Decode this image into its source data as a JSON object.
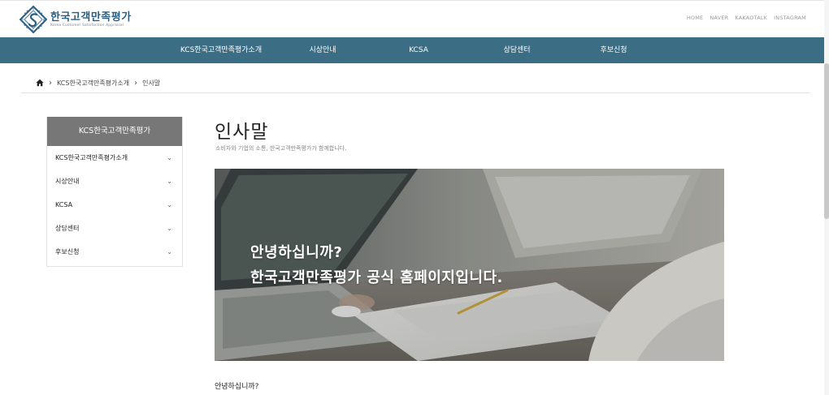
{
  "header": {
    "logo_title": "한국고객만족평가",
    "logo_subtitle": "Korea Customer Satisfaction Appraisal",
    "util_links": [
      "HOME",
      "NAVER",
      "KAKAOTALK",
      "INSTAGRAM"
    ]
  },
  "nav": {
    "items": [
      "KCS한국고객만족평가소개",
      "시상안내",
      "KCSA",
      "상담센터",
      "후보신청"
    ]
  },
  "breadcrumb": {
    "items": [
      "KCS한국고객만족평가소개",
      "인사말"
    ]
  },
  "sidebar": {
    "title": "KCS한국고객만족평가",
    "items": [
      {
        "label": "KCS한국고객만족평가소개"
      },
      {
        "label": "시상안내"
      },
      {
        "label": "KCSA"
      },
      {
        "label": "상담센터"
      },
      {
        "label": "후보신청"
      }
    ]
  },
  "main": {
    "title": "인사말",
    "subtitle": "소비자와 기업의 소통, 한국고객만족평가가 함께합니다.",
    "banner_line1": "안녕하십니까?",
    "banner_line2": "한국고객만족평가 공식 홈페이지입니다.",
    "body_first_line": "안녕하십니까?"
  },
  "colors": {
    "nav_bg": "#3b6d84",
    "logo_blue": "#2a5e80",
    "sidebar_head_bg": "#777777"
  }
}
